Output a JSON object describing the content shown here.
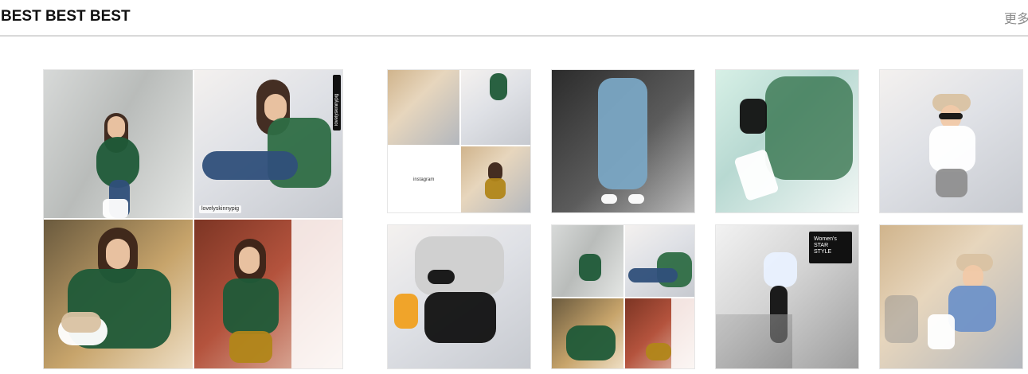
{
  "header": {
    "title": "BEST BEST BEST",
    "more_label": "更多"
  },
  "tiles": {
    "big": {
      "watermark_top": "lovelyskinnypig",
      "watermark_bottom": "lovelyskinnypig"
    },
    "small": {
      "collage_caption": "instagram",
      "stair_sign": "Women's\nSTAR\nSTYLE"
    }
  },
  "colors": {
    "header_divider": "#d9d9d9",
    "title_text": "#111111",
    "more_text": "#8b8b8b"
  },
  "icons": {
    "more": "more-link"
  }
}
